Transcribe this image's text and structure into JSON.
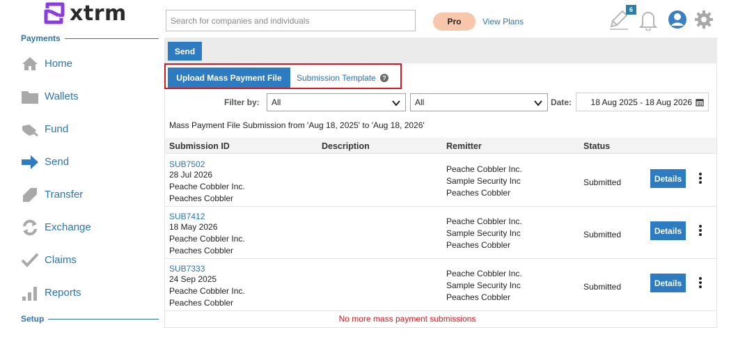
{
  "brand": {
    "name": "xtrm"
  },
  "sidebar": {
    "payments_label": "Payments",
    "setup_label": "Setup",
    "items": [
      {
        "label": "Home",
        "icon": "home-icon"
      },
      {
        "label": "Wallets",
        "icon": "folder-icon"
      },
      {
        "label": "Fund",
        "icon": "fund-icon"
      },
      {
        "label": "Send",
        "icon": "arrow-right-icon"
      },
      {
        "label": "Transfer",
        "icon": "transfer-icon"
      },
      {
        "label": "Exchange",
        "icon": "exchange-icon"
      },
      {
        "label": "Claims",
        "icon": "check-icon"
      },
      {
        "label": "Reports",
        "icon": "bar-chart-icon"
      }
    ]
  },
  "header": {
    "search_placeholder": "Search for companies and individuals",
    "plan_label": "Pro",
    "view_plans": "View Plans",
    "notification_badge": "6"
  },
  "toolbar": {
    "send_label": "Send"
  },
  "actions": {
    "upload_label": "Upload Mass Payment File",
    "template_label": "Submission Template",
    "help_glyph": "?"
  },
  "filters": {
    "filter_label": "Filter by:",
    "select1_value": "All",
    "select2_value": "All",
    "date_label": "Date:",
    "date_range": "18 Aug 2025 - 18 Aug 2026"
  },
  "summary": "Mass Payment File Submission from 'Aug 18, 2025' to 'Aug 18, 2026'",
  "table": {
    "headers": {
      "submission_id": "Submission ID",
      "description": "Description",
      "remitter": "Remitter",
      "status": "Status"
    },
    "details_label": "Details",
    "rows": [
      {
        "id": "SUB7502",
        "date": "28 Jul 2026",
        "line2": "Peache Cobbler Inc.",
        "line3": "Peaches Cobbler",
        "rem1": "Peache Cobbler Inc.",
        "rem2": "Sample Security Inc",
        "rem3": "Peaches Cobbler",
        "status": "Submitted"
      },
      {
        "id": "SUB7412",
        "date": "18 May 2026",
        "line2": "Peache Cobbler Inc.",
        "line3": "Peaches Cobbler",
        "rem1": "Peache Cobbler Inc.",
        "rem2": "Sample Security Inc",
        "rem3": "Peaches Cobbler",
        "status": "Submitted"
      },
      {
        "id": "SUB7333",
        "date": "24 Sep 2025",
        "line2": "Peache Cobbler Inc.",
        "line3": "Peaches Cobbler",
        "rem1": "Peache Cobbler Inc.",
        "rem2": "Sample Security Inc",
        "rem3": "Peaches Cobbler",
        "status": "Submitted"
      }
    ],
    "footer_message": "No more mass payment submissions"
  },
  "colors": {
    "accent": "#2d7bc0",
    "link": "#2d73b3",
    "highlight": "#d9161b",
    "pro_pill": "#f8c6ab",
    "logo": "#8a3ddb"
  }
}
